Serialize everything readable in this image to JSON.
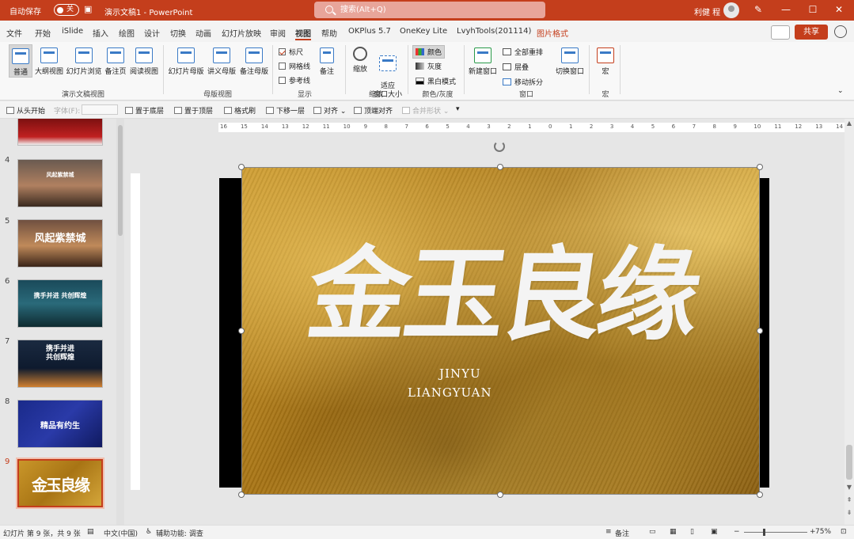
{
  "titlebar": {
    "autosave_label": "自动保存",
    "autosave_state": "关",
    "doc_title": "演示文稿1 - PowerPoint",
    "search_placeholder": "搜索(Alt+Q)",
    "user_name": "利健 程"
  },
  "menu": {
    "tabs": [
      "文件",
      "开始",
      "iSlide",
      "插入",
      "绘图",
      "设计",
      "切换",
      "动画",
      "幻灯片放映",
      "审阅",
      "视图",
      "帮助",
      "OKPlus 5.7",
      "OneKey Lite",
      "LvyhTools(201114)",
      "图片格式"
    ],
    "active_tab": "视图",
    "share_label": "共享"
  },
  "ribbon": {
    "presentation_views": {
      "buttons": [
        "普通",
        "大纲视图",
        "幻灯片浏览",
        "备注页",
        "阅读视图"
      ],
      "group_label": "演示文稿视图"
    },
    "master_views": {
      "buttons": [
        "幻灯片母版",
        "讲义母版",
        "备注母版"
      ],
      "group_label": "母版视图"
    },
    "show": {
      "checkboxes": [
        {
          "label": "标尺",
          "checked": true
        },
        {
          "label": "网格线",
          "checked": false
        },
        {
          "label": "参考线",
          "checked": false
        }
      ],
      "notes_label": "备注",
      "group_label": "显示"
    },
    "zoom": {
      "zoom_label": "缩放",
      "fit_label": "适应\n窗口大小",
      "group_label": "缩放"
    },
    "color": {
      "items": [
        "颜色",
        "灰度",
        "黑白模式"
      ],
      "group_label": "颜色/灰度"
    },
    "window": {
      "new_window": "新建窗口",
      "items": [
        "全部重排",
        "层叠",
        "移动拆分"
      ],
      "switch": "切换窗口",
      "group_label": "窗口"
    },
    "macro": {
      "label": "宏",
      "group_label": "宏"
    }
  },
  "quickbar": {
    "items": [
      "从头开始",
      "字体(F):",
      "置于底层",
      "置于顶层",
      "格式刷",
      "下移一层",
      "对齐",
      "顶端对齐",
      "合并形状"
    ]
  },
  "thumbnails": [
    {
      "num": "4",
      "text": "风起紫禁城",
      "style": "palace-dusk"
    },
    {
      "num": "5",
      "text": "风起紫禁城",
      "style": "palace-dusk-large"
    },
    {
      "num": "6",
      "text": "携手并进  共创辉煌",
      "style": "mountain-teal"
    },
    {
      "num": "7",
      "text": "携手并进\n共创辉煌",
      "style": "city-night"
    },
    {
      "num": "8",
      "text": "精品有约生",
      "style": "blue"
    },
    {
      "num": "9",
      "text": "金玉良缘",
      "style": "gold",
      "selected": true
    }
  ],
  "slide": {
    "title": "金玉良缘",
    "pinyin_line1": "JINYU",
    "pinyin_line2": "LIANGYUAN",
    "ruler_ticks": [
      "16",
      "15",
      "14",
      "13",
      "12",
      "11",
      "10",
      "9",
      "8",
      "7",
      "6",
      "5",
      "4",
      "3",
      "2",
      "1",
      "0",
      "1",
      "2",
      "3",
      "4",
      "5",
      "6",
      "7",
      "8",
      "9",
      "10",
      "11",
      "12",
      "13",
      "14",
      "15",
      "16"
    ]
  },
  "status": {
    "slide_info": "幻灯片 第 9 张，共 9 张",
    "language": "中文(中国)",
    "accessibility": "辅助功能: 调查",
    "notes": "备注",
    "zoom": "75%"
  },
  "colors": {
    "accent": "#c43e1c",
    "gold": "#c9962a"
  }
}
